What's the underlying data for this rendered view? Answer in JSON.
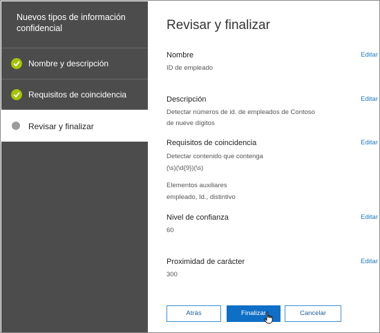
{
  "wizard": {
    "title": "Nuevos tipos de información confidencial",
    "steps": [
      {
        "label": "Nombre y descripción",
        "state": "done"
      },
      {
        "label": "Requisitos de coincidencia",
        "state": "done"
      },
      {
        "label": "Revisar y finalizar",
        "state": "current"
      }
    ]
  },
  "main": {
    "title": "Revisar y finalizar",
    "edit_label": "Editar",
    "name": {
      "heading": "Nombre",
      "value": "ID de empleado"
    },
    "description": {
      "heading": "Descripción",
      "value": "Detectar números de id. de empleados de Contoso de nueve dígitos"
    },
    "requirements": {
      "heading": "Requisitos de coincidencia",
      "detect_text": "Detectar contenido que contenga",
      "pattern": "(\\s)(\\d{9})(\\s)",
      "aux_heading": "Elementos auxiliares",
      "aux_values": "empleado, Id., distintivo"
    },
    "confidence": {
      "heading": "Nivel de confianza",
      "value": "60"
    },
    "proximity": {
      "heading": "Proximidad de carácter",
      "value": "300"
    }
  },
  "buttons": {
    "back": "Atrás",
    "finish": "Finalizar",
    "cancel": "Cancelar"
  },
  "colors": {
    "sidebar_bg": "#4c4c4c",
    "done_green": "#a4c400",
    "link_blue": "#1f7ac0",
    "primary_blue": "#0f6fc6"
  },
  "icons": {
    "done": "checkmark-icon",
    "current": "dot-icon",
    "cursor": "hand-pointer-icon"
  }
}
